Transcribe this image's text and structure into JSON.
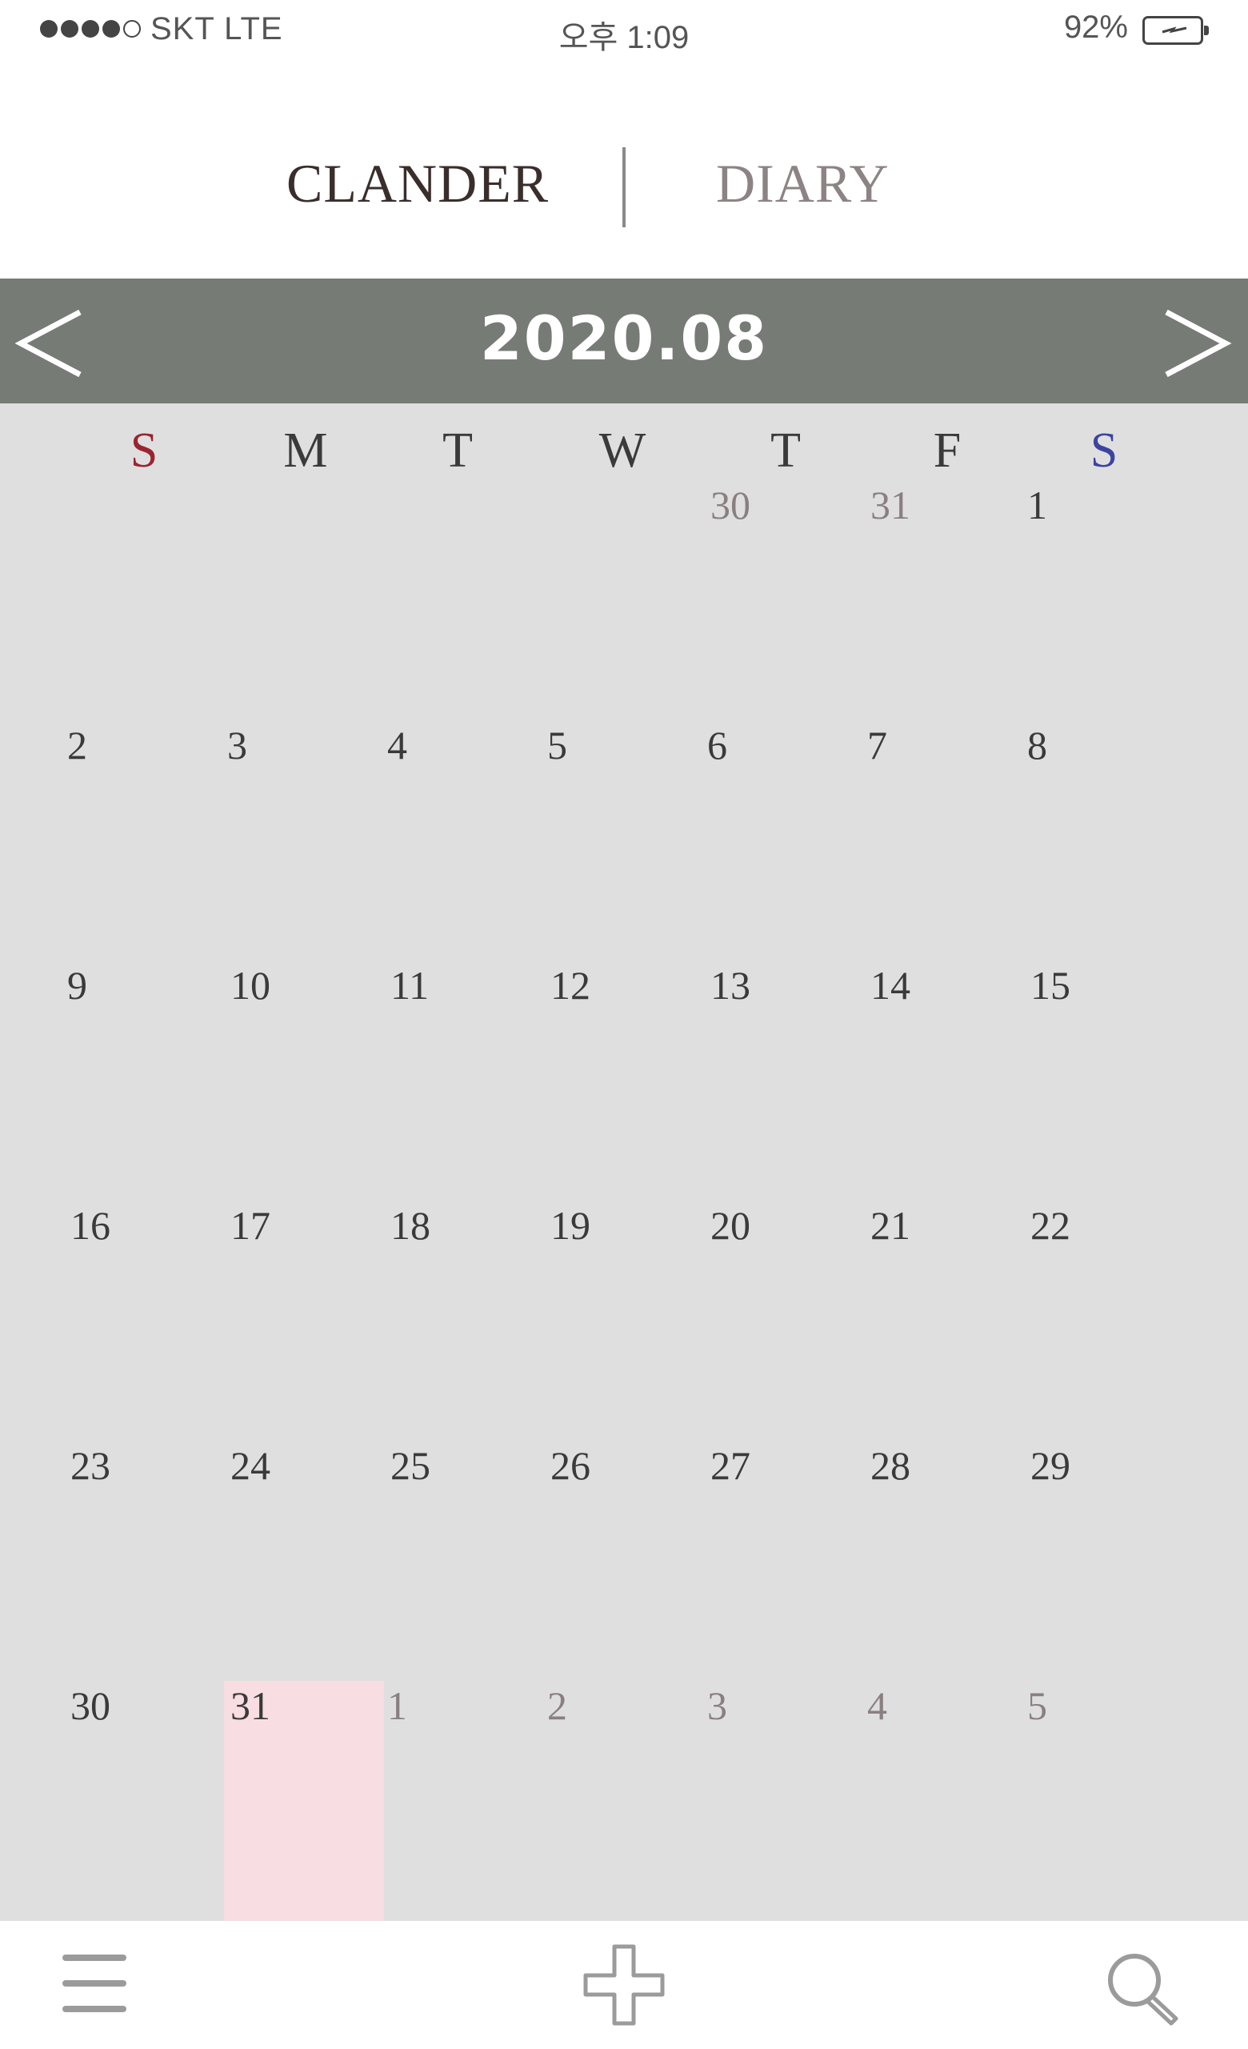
{
  "status_bar": {
    "carrier": "SKT   LTE",
    "signal_bars_filled": 4,
    "signal_bars_total": 5,
    "time": "오후 1:09",
    "battery": "92%"
  },
  "tabs": {
    "calendar_label": "CLANDER",
    "diary_label": "DIARY",
    "active": "calendar"
  },
  "month_header": {
    "title": "2020.08",
    "prev_icon": "chevron-left-icon",
    "next_icon": "chevron-right-icon"
  },
  "weekdays": [
    "S",
    "M",
    "T",
    "W",
    "T",
    "F",
    "S"
  ],
  "weeks": [
    [
      {
        "d": ""
      },
      {
        "d": ""
      },
      {
        "d": ""
      },
      {
        "d": ""
      },
      {
        "d": "30",
        "muted": true
      },
      {
        "d": "31",
        "muted": true
      },
      {
        "d": "1"
      }
    ],
    [
      {
        "d": "2"
      },
      {
        "d": "3"
      },
      {
        "d": "4"
      },
      {
        "d": "5"
      },
      {
        "d": "6"
      },
      {
        "d": "7"
      },
      {
        "d": "8"
      }
    ],
    [
      {
        "d": "9"
      },
      {
        "d": "10"
      },
      {
        "d": "11"
      },
      {
        "d": "12"
      },
      {
        "d": "13"
      },
      {
        "d": "14"
      },
      {
        "d": "15"
      }
    ],
    [
      {
        "d": "16"
      },
      {
        "d": "17"
      },
      {
        "d": "18"
      },
      {
        "d": "19"
      },
      {
        "d": "20"
      },
      {
        "d": "21"
      },
      {
        "d": "22"
      }
    ],
    [
      {
        "d": "23"
      },
      {
        "d": "24"
      },
      {
        "d": "25"
      },
      {
        "d": "26"
      },
      {
        "d": "27"
      },
      {
        "d": "28"
      },
      {
        "d": "29"
      }
    ],
    [
      {
        "d": "30"
      },
      {
        "d": "31"
      },
      {
        "d": "1",
        "muted": true
      },
      {
        "d": "2",
        "muted": true
      },
      {
        "d": "3",
        "muted": true
      },
      {
        "d": "4",
        "muted": true
      },
      {
        "d": "5",
        "muted": true
      }
    ]
  ],
  "highlighted_date": "31",
  "colors": {
    "header_bg": "#767b76",
    "calendar_bg": "#dfdfe0",
    "highlight": "#f8dde2",
    "sunday": "#9b2430",
    "saturday": "#3c44a0"
  },
  "bottom_bar": {
    "menu_icon": "hamburger-menu-icon",
    "add_icon": "plus-icon",
    "search_icon": "search-icon"
  }
}
